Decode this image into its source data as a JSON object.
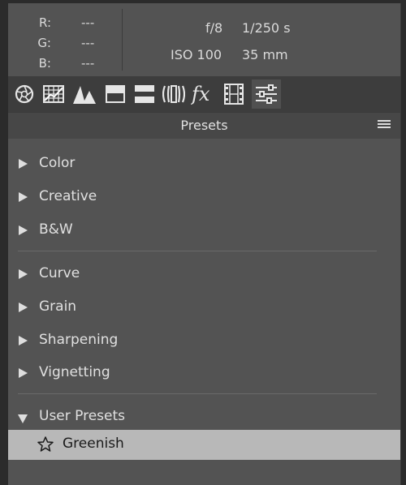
{
  "info": {
    "r_label": "R:",
    "r_value": "---",
    "g_label": "G:",
    "g_value": "---",
    "b_label": "B:",
    "b_value": "---",
    "aperture": "f/8",
    "shutter": "1/250 s",
    "iso": "ISO 100",
    "focal_length": "35 mm"
  },
  "toolbar": {
    "tools": [
      {
        "name": "aperture-icon"
      },
      {
        "name": "grid-icon"
      },
      {
        "name": "mountains-icon"
      },
      {
        "name": "split-panel-icon"
      },
      {
        "name": "split-toning-icon"
      },
      {
        "name": "lens-icon"
      },
      {
        "name": "fx-icon"
      },
      {
        "name": "film-strip-icon"
      },
      {
        "name": "sliders-icon",
        "active": true
      }
    ]
  },
  "presets": {
    "title": "Presets",
    "groups": [
      {
        "label": "Color"
      },
      {
        "label": "Creative"
      },
      {
        "label": "B&W"
      },
      {
        "label": "Curve"
      },
      {
        "label": "Grain"
      },
      {
        "label": "Sharpening"
      },
      {
        "label": "Vignetting"
      },
      {
        "label": "User Presets"
      }
    ],
    "user_presets": [
      {
        "label": "Greenish",
        "selected": true
      }
    ]
  },
  "colors": {
    "panel_bg": "#535353",
    "toolbar_bg": "#3d3d3d",
    "header_bg": "#474747",
    "selected_bg": "#b8b8b8",
    "text": "#dcdcdc"
  }
}
